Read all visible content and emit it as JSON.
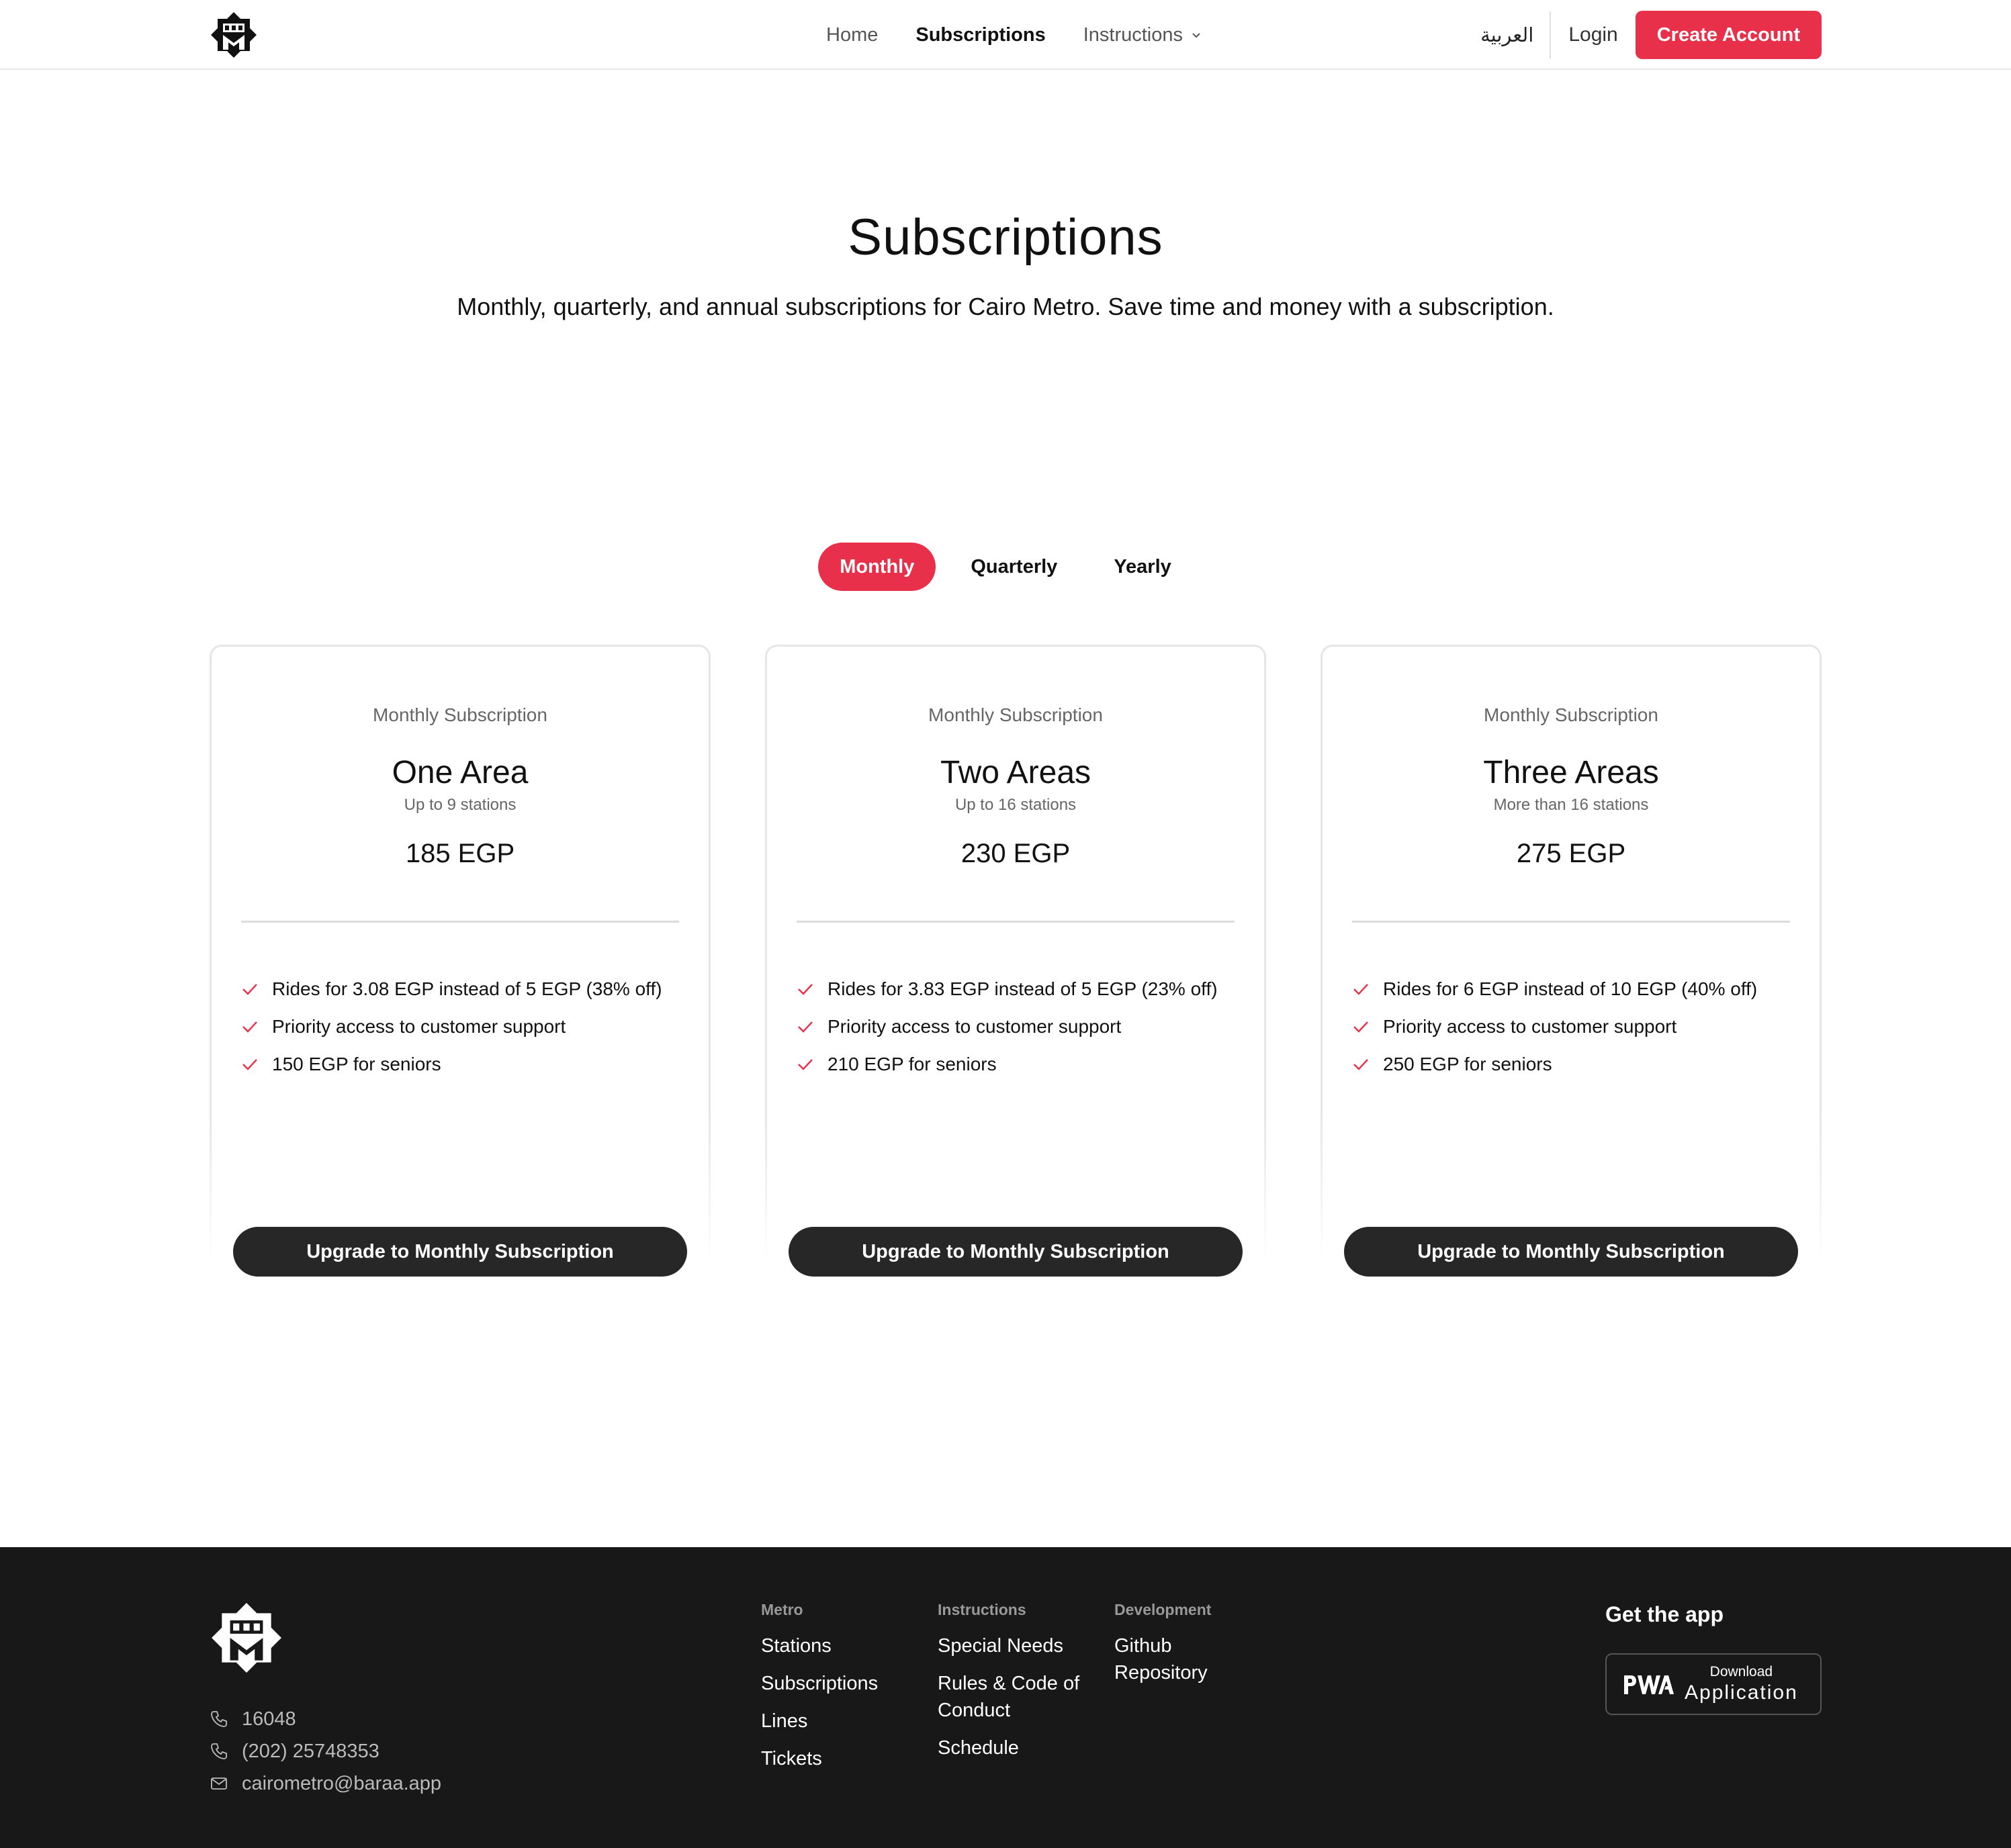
{
  "header": {
    "nav": [
      {
        "label": "Home"
      },
      {
        "label": "Subscriptions",
        "active": true
      },
      {
        "label": "Instructions",
        "dropdown": true
      }
    ],
    "language": "العربية",
    "login": "Login",
    "create_account": "Create Account"
  },
  "hero": {
    "title": "Subscriptions",
    "subtitle": "Monthly, quarterly, and annual subscriptions for Cairo Metro. Save time and money with a subscription."
  },
  "tabs": [
    {
      "label": "Monthly",
      "active": true
    },
    {
      "label": "Quarterly"
    },
    {
      "label": "Yearly"
    }
  ],
  "cards": [
    {
      "kicker": "Monthly Subscription",
      "title": "One Area",
      "stations": "Up to 9 stations",
      "price": "185 EGP",
      "features": [
        "Rides for 3.08 EGP instead of 5 EGP (38% off)",
        "Priority access to customer support",
        "150 EGP for seniors"
      ],
      "button": "Upgrade to Monthly Subscription"
    },
    {
      "kicker": "Monthly Subscription",
      "title": "Two Areas",
      "stations": "Up to 16 stations",
      "price": "230 EGP",
      "features": [
        "Rides for 3.83 EGP instead of 5 EGP (23% off)",
        "Priority access to customer support",
        "210 EGP for seniors"
      ],
      "button": "Upgrade to Monthly Subscription"
    },
    {
      "kicker": "Monthly Subscription",
      "title": "Three Areas",
      "stations": "More than 16 stations",
      "price": "275 EGP",
      "features": [
        "Rides for 6 EGP instead of 10 EGP (40% off)",
        "Priority access to customer support",
        "250 EGP for seniors"
      ],
      "button": "Upgrade to Monthly Subscription"
    }
  ],
  "footer": {
    "contact": [
      {
        "icon": "phone-icon",
        "text": "16048"
      },
      {
        "icon": "phone-icon",
        "text": "(202) 25748353"
      },
      {
        "icon": "mail-icon",
        "text": "cairometro@baraa.app"
      }
    ],
    "columns": [
      {
        "heading": "Metro",
        "links": [
          "Stations",
          "Subscriptions",
          "Lines",
          "Tickets"
        ]
      },
      {
        "heading": "Instructions",
        "links": [
          "Special Needs",
          "Rules & Code of Conduct",
          "Schedule"
        ]
      },
      {
        "heading": "Development",
        "links": [
          "Github Repository"
        ]
      }
    ],
    "get_app": "Get the app",
    "pwa": {
      "small": "Download",
      "big": "Application"
    }
  },
  "colors": {
    "accent": "#e8304a",
    "button_dark": "#272727",
    "footer_bg": "#181818"
  }
}
